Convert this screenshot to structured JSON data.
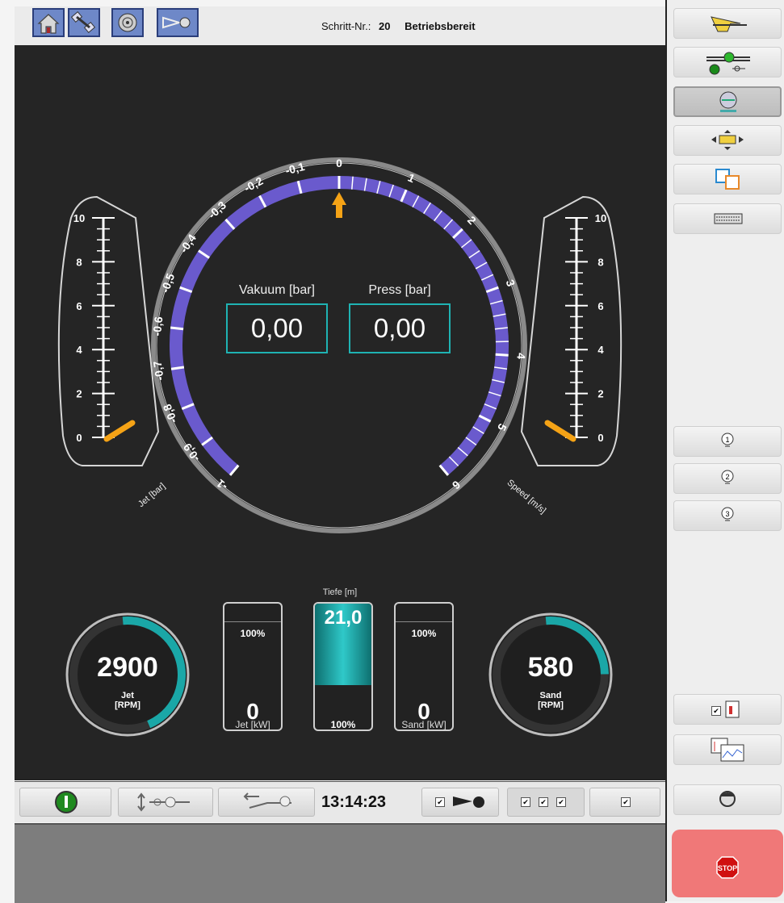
{
  "header": {
    "step_label": "Schritt-Nr.:",
    "step_number": "20",
    "status": "Betriebsbereit",
    "buttons": [
      "home-icon",
      "satellite-icon",
      "spiral-icon",
      "nozzle-icon"
    ]
  },
  "main_gauge": {
    "vacuum_ticks": [
      "0",
      "-0,1",
      "-0,2",
      "-0,3",
      "-0,4",
      "-0,5",
      "-0,6",
      "-0,7",
      "-0,8",
      "-0,9",
      "-1"
    ],
    "press_ticks": [
      "1",
      "2",
      "3",
      "4",
      "5",
      "6"
    ],
    "vacuum_label": "Vakuum [bar]",
    "vacuum_value": "0,00",
    "press_label": "Press [bar]",
    "press_value": "0,00",
    "pointer_value": 0,
    "accent_color": "#6a5acd"
  },
  "jet_gauge": {
    "label": "Jet [bar]",
    "ticks": [
      "10",
      "8",
      "6",
      "4",
      "2",
      "0"
    ],
    "value": 0
  },
  "speed_gauge": {
    "label": "Speed [m/s]",
    "ticks": [
      "10",
      "8",
      "6",
      "4",
      "2",
      "0"
    ],
    "value": 0
  },
  "jet_rpm": {
    "value": "2900",
    "label_line1": "Jet",
    "label_line2": "[RPM]",
    "level": 0.6
  },
  "sand_rpm": {
    "value": "580",
    "label_line1": "Sand",
    "label_line2": "[RPM]",
    "level": 0.35
  },
  "jet_kw": {
    "percent": "100%",
    "value": "0",
    "label": "Jet [kW]"
  },
  "sand_kw": {
    "percent": "100%",
    "value": "0",
    "label": "Sand [kW]"
  },
  "depth": {
    "title": "Tiefe [m]",
    "value": "21,0",
    "percent": "100%",
    "level": 0.65,
    "color": "#1aa7a7"
  },
  "bottombar": {
    "clock": "13:14:23"
  },
  "right_panel": {
    "buttons": [
      "boat-icon",
      "motor-valve-icon",
      "spool-icon",
      "positioner-icon",
      "nn-icon",
      "keyboard-icon",
      "lamp-1-icon",
      "lamp-2-icon",
      "lamp-3-icon",
      "report-icon",
      "chart-icon",
      "operator-icon"
    ],
    "stop_label": "STOP"
  }
}
